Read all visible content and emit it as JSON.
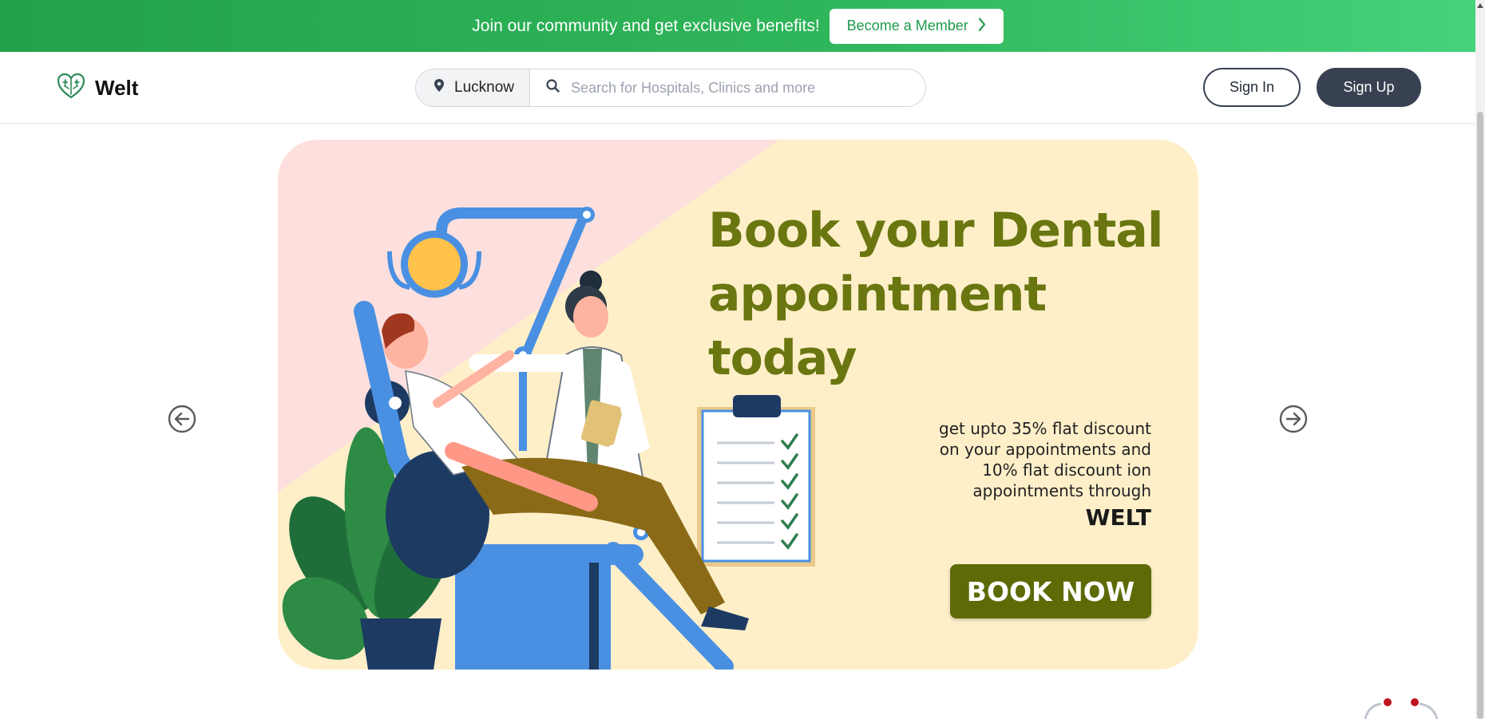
{
  "promo": {
    "text": "Join our community and get exclusive benefits!",
    "button_label": "Become a Member",
    "button_icon": "chevron-right-icon"
  },
  "header": {
    "logo_text": "Welt",
    "logo_icon": "brain-heart-icon",
    "location": "Lucknow",
    "location_icon": "map-pin-icon",
    "search_icon": "search-icon",
    "search_placeholder": "Search for Hospitals, Clinics and more",
    "search_value": "",
    "signin_label": "Sign In",
    "signup_label": "Sign Up"
  },
  "banner": {
    "headline_line1": "Book your Dental",
    "headline_line2": "appointment",
    "headline_line3": "today",
    "sub_line1": "get upto 35% flat discount",
    "sub_line2": "on your appointments and",
    "sub_line3": "10% flat discount ion",
    "sub_line4": "appointments through",
    "brand": "WELT",
    "cta_label": "BOOK NOW",
    "prev_icon": "arrow-left-circle-icon",
    "next_icon": "arrow-right-circle-icon"
  },
  "colors": {
    "promo_green": "#22a24a",
    "dark_slate": "#374151",
    "banner_cream": "#feefc9",
    "banner_pink": "#fde0de",
    "headline_olive": "#6a7610",
    "cta_olive": "#5d6a05",
    "chair_blue": "#4a90e2"
  }
}
